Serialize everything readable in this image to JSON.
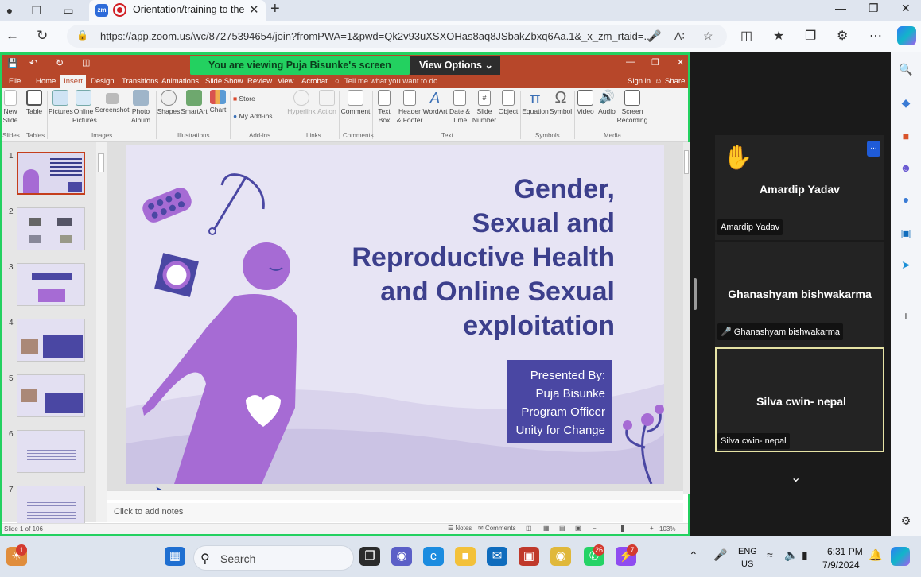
{
  "browser": {
    "tab_title": "Orientation/training to the c",
    "tab_favicon": "zm",
    "url": "https://app.zoom.us/wc/87275394654/join?fromPWA=1&pwd=Qk2v93uXSXOHas8aq8JSbakZbxq6Aa.1&_x_zm_rtaid=..."
  },
  "zoom": {
    "viewing_banner": "You are viewing  Puja Bisunke's screen",
    "view_options": "View Options",
    "participants": [
      {
        "display_name": "Amardip Yadav",
        "tag": "Amardip Yadav",
        "hand_raised": true
      },
      {
        "display_name": "Ghanashyam bishwakarma",
        "tag": "Ghanashyam bishwakarma",
        "muted": true
      },
      {
        "display_name": "Silva cwin- nepal",
        "tag": "Silva cwin- nepal",
        "active_speaker": true
      }
    ],
    "more_button": "..."
  },
  "powerpoint": {
    "ribbon_tabs": [
      "File",
      "Home",
      "Insert",
      "Design",
      "Transitions",
      "Animations",
      "Slide Show",
      "Review",
      "View",
      "Acrobat"
    ],
    "tell_me": "Tell me what you want to do...",
    "sign_in": "Sign in",
    "share": "Share",
    "ribbon_buttons": [
      {
        "label": "New\nSlide"
      },
      {
        "label": "Table"
      },
      {
        "label": "Pictures"
      },
      {
        "label": "Online\nPictures"
      },
      {
        "label": "Screenshot"
      },
      {
        "label": "Photo\nAlbum"
      },
      {
        "label": "Shapes"
      },
      {
        "label": "SmartArt"
      },
      {
        "label": "Chart"
      },
      {
        "label": "Store"
      },
      {
        "label": "My Add-ins"
      },
      {
        "label": "Hyperlink"
      },
      {
        "label": "Action"
      },
      {
        "label": "Comment"
      },
      {
        "label": "Text\nBox"
      },
      {
        "label": "Header\n& Footer"
      },
      {
        "label": "WordArt"
      },
      {
        "label": "Date &\nTime"
      },
      {
        "label": "Slide\nNumber"
      },
      {
        "label": "Object"
      },
      {
        "label": "Equation"
      },
      {
        "label": "Symbol"
      },
      {
        "label": "Video"
      },
      {
        "label": "Audio"
      },
      {
        "label": "Screen\nRecording"
      }
    ],
    "ribbon_groups": [
      "Slides",
      "Tables",
      "Images",
      "Illustrations",
      "Add-ins",
      "Links",
      "Comments",
      "Text",
      "Symbols",
      "Media"
    ],
    "thumb_numbers": [
      "1",
      "2",
      "3",
      "4",
      "5",
      "6",
      "7"
    ],
    "slide": {
      "title_lines": [
        "Gender,",
        "Sexual and",
        "Reproductive Health",
        "and Online Sexual",
        "exploitation"
      ],
      "presenter_lines": [
        "Presented By:",
        "Puja Bisunke",
        "Program Officer",
        "Unity for Change"
      ]
    },
    "notes_placeholder": "Click to add notes",
    "status_left": "Slide 1 of 106",
    "status_notes": "Notes",
    "status_comments": "Comments",
    "zoom_level": "103%"
  },
  "taskbar": {
    "search_label": "Search",
    "lang_top": "ENG",
    "lang_bottom": "US",
    "time": "6:31 PM",
    "date": "7/9/2024",
    "badges": {
      "widget": "1",
      "whatsapp": "26",
      "messenger": "7"
    }
  },
  "colors": {
    "zoom_green": "#23d160",
    "ppt_accent": "#b7472a",
    "slide_bg": "#e7e4f4",
    "slide_title": "#3c3f8c",
    "figure": "#a66bd4",
    "presenter_box": "#4a47a3"
  }
}
